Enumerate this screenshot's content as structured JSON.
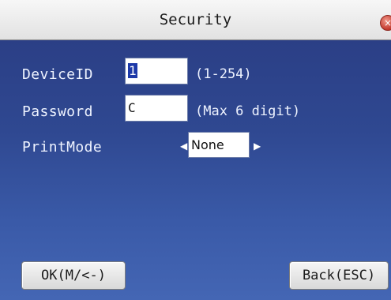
{
  "window": {
    "title": "Security",
    "close_icon": "close-icon",
    "accent_color": "#c2372c",
    "background_color": "#2f4891"
  },
  "form": {
    "device_id": {
      "label": "DeviceID",
      "value": "1",
      "hint": "(1-254)"
    },
    "password": {
      "label": "Password",
      "value": "C",
      "hint": "(Max 6 digit)"
    },
    "print_mode": {
      "label": "PrintMode",
      "value": "None",
      "left_arrow_icon": "arrow-left-icon",
      "right_arrow_icon": "arrow-right-icon"
    }
  },
  "buttons": {
    "ok_label": "OK(M/<-)",
    "back_label": "Back(ESC)"
  }
}
